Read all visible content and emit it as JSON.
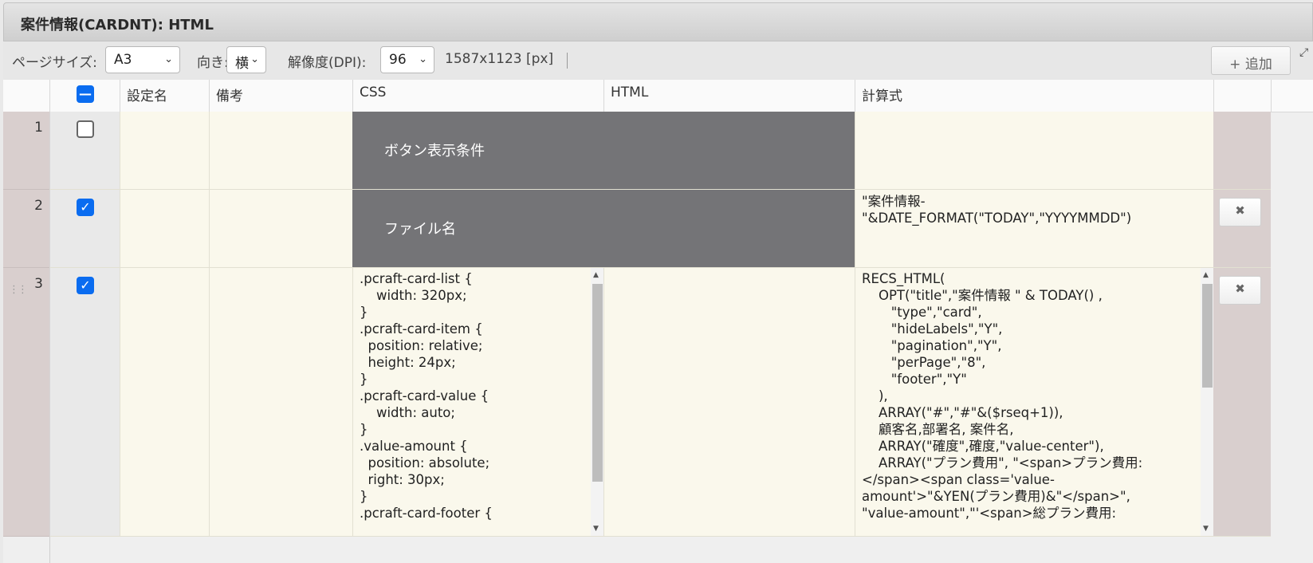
{
  "window": {
    "title": "案件情報(CARDNT): HTML"
  },
  "toolbar": {
    "page_size_label": "ページサイズ:",
    "page_size_value": "A3",
    "orientation_label": "向き:",
    "orientation_value": "横",
    "dpi_label": "解像度(DPI):",
    "dpi_value": "96",
    "dimensions": "1587x1123 [px]",
    "add_label": "+ 追加"
  },
  "table": {
    "columns": [
      "設定名",
      "備考",
      "CSS",
      "HTML",
      "計算式"
    ],
    "rows": [
      {
        "num": "1",
        "checked": false,
        "merged_css_html": "ボタン表示条件",
        "formula": ""
      },
      {
        "num": "2",
        "checked": true,
        "merged_css_html": "ファイル名",
        "formula": "\"案件情報-\n\"&DATE_FORMAT(\"TODAY\",\"YYYYMMDD\")"
      },
      {
        "num": "3",
        "checked": true,
        "css": ".pcraft-card-list {\n    width: 320px;\n}\n.pcraft-card-item {\n  position: relative;\n  height: 24px;\n}\n.pcraft-card-value {\n    width: auto;\n}\n.value-amount {\n  position: absolute;\n  right: 30px;\n}\n.pcraft-card-footer {",
        "html": "",
        "formula": "RECS_HTML(\n    OPT(\"title\",\"案件情報 \" & TODAY() ,\n       \"type\",\"card\",\n       \"hideLabels\",\"Y\",\n       \"pagination\",\"Y\",\n       \"perPage\",\"8\",\n       \"footer\",\"Y\"\n    ),\n    ARRAY(\"#\",\"#\"&($rseq+1)),\n    顧客名,部署名, 案件名,\n    ARRAY(\"確度\",確度,\"value-center\"),\n    ARRAY(\"プラン費用\", \"<span>プラン費用:\n</span><span class='value-\namount'>\"&YEN(プラン費用)&\"</span>\",\n\"value-amount\",\"'<span>総プラン費用:"
      }
    ]
  }
}
